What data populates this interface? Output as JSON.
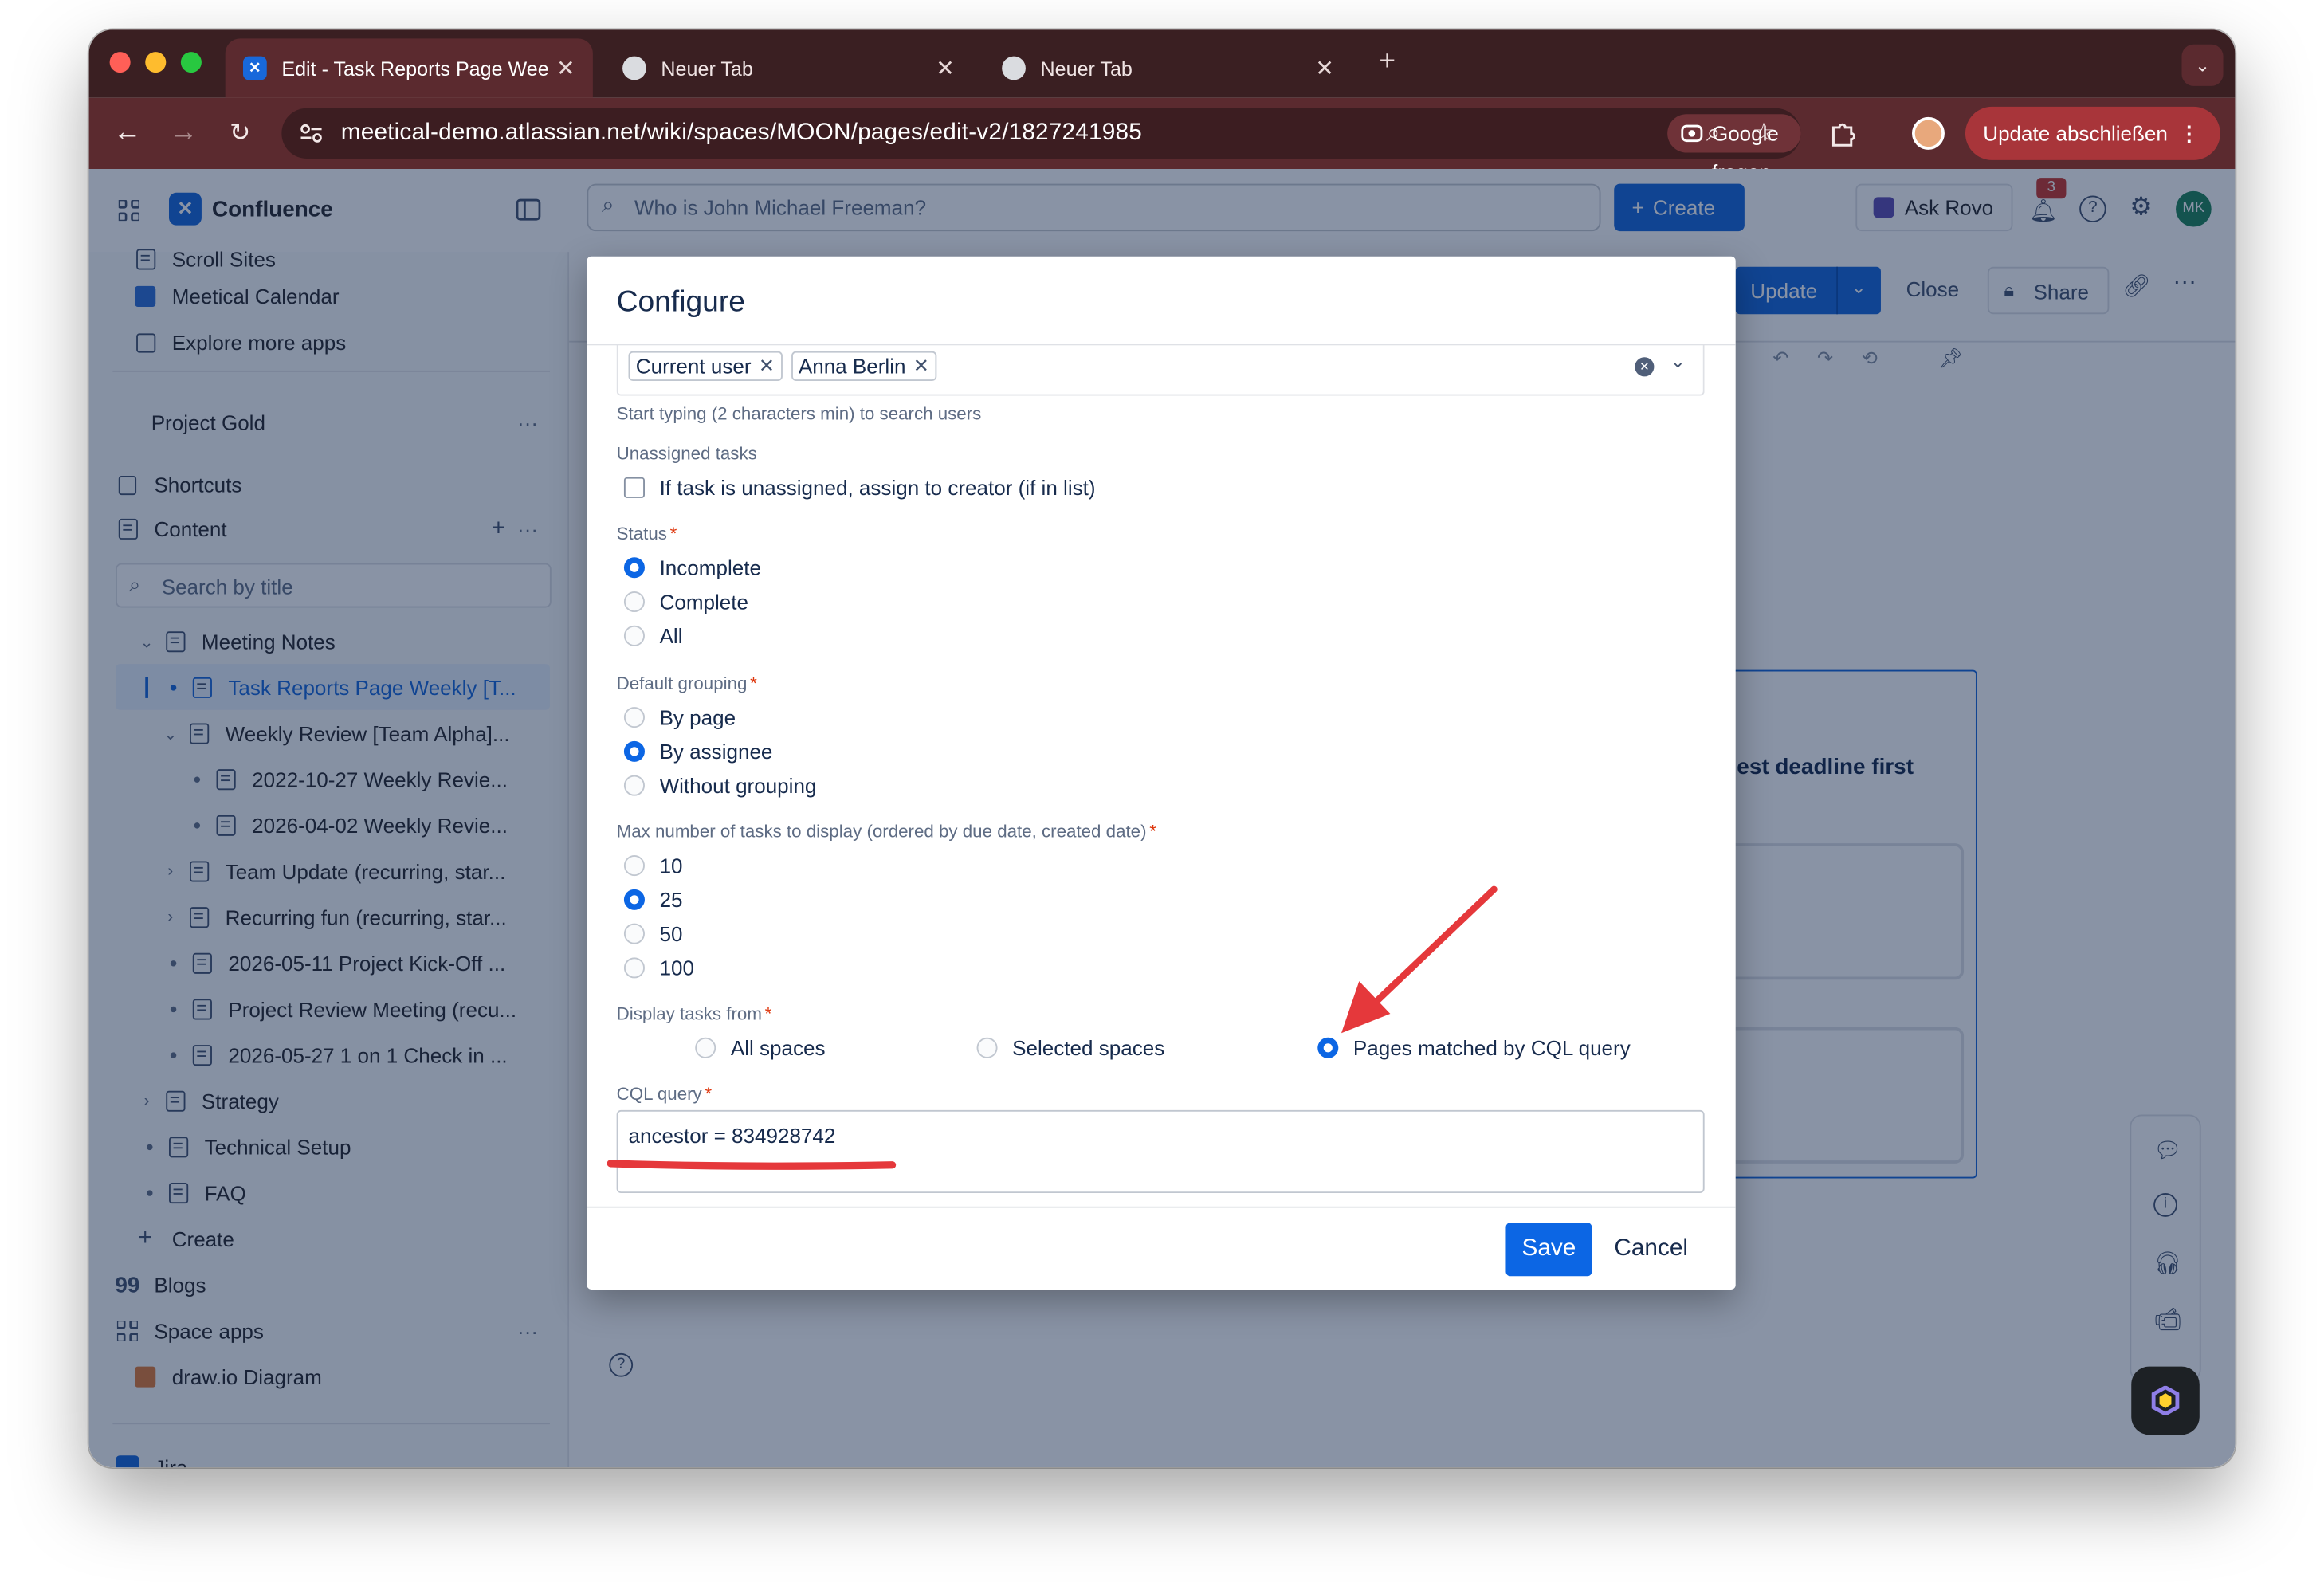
{
  "browser": {
    "tabs": [
      {
        "title": "Edit - Task Reports Page Wee"
      },
      {
        "title": "Neuer Tab"
      },
      {
        "title": "Neuer Tab"
      }
    ],
    "url": "meetical-demo.atlassian.net/wiki/spaces/MOON/pages/edit-v2/1827241985",
    "google_button": "Google fragen",
    "update_button": "Update abschließen",
    "avatar_color": "#e8a87c"
  },
  "topbar": {
    "product": "Confluence",
    "search_placeholder": "Who is John Michael Freeman?",
    "create_label": "Create",
    "rovo_label": "Ask Rovo",
    "notification_count": "3",
    "user_initials": "MK"
  },
  "editor_toolbar": {
    "update_label": "Update",
    "close_label": "Close",
    "share_label": "Share"
  },
  "sidebar": {
    "items": [
      {
        "label": "Scroll Sites"
      },
      {
        "label": "Meetical Calendar"
      },
      {
        "label": "Explore more apps"
      },
      {
        "label": "Project Gold"
      },
      {
        "label": "Shortcuts"
      },
      {
        "label": "Content"
      }
    ],
    "search_placeholder": "Search by title",
    "tree": [
      {
        "label": "Meeting Notes"
      },
      {
        "label": "Task Reports Page Weekly [T..."
      },
      {
        "label": "Weekly Review [Team Alpha]..."
      },
      {
        "label": "2022-10-27 Weekly Revie..."
      },
      {
        "label": "2026-04-02 Weekly Revie..."
      },
      {
        "label": "Team Update (recurring, star..."
      },
      {
        "label": "Recurring fun (recurring, star..."
      },
      {
        "label": "2026-05-11 Project Kick-Off ..."
      },
      {
        "label": "Project Review Meeting (recu..."
      },
      {
        "label": "2026-05-27 1 on 1 Check in ..."
      },
      {
        "label": "Strategy"
      },
      {
        "label": "Technical Setup"
      },
      {
        "label": "FAQ"
      }
    ],
    "create_label": "Create",
    "blogs_label": "Blogs",
    "space_apps_label": "Space apps",
    "drawio_label": "draw.io Diagram",
    "jira_label": "Jira"
  },
  "background_text": "earliest deadline first",
  "dialog": {
    "title": "Configure",
    "users": [
      "Current user",
      "Anna Berlin"
    ],
    "users_hint": "Start typing (2 characters min) to search users",
    "unassigned_label": "Unassigned tasks",
    "unassigned_checkbox": "If task is unassigned, assign to creator (if in list)",
    "status_label": "Status",
    "status_options": [
      "Incomplete",
      "Complete",
      "All"
    ],
    "status_selected": "Incomplete",
    "grouping_label": "Default grouping",
    "grouping_options": [
      "By page",
      "By assignee",
      "Without grouping"
    ],
    "grouping_selected": "By assignee",
    "max_label": "Max number of tasks to display (ordered by due date, created date)",
    "max_options": [
      "10",
      "25",
      "50",
      "100"
    ],
    "max_selected": "25",
    "source_label": "Display tasks from",
    "source_options": [
      "All spaces",
      "Selected spaces",
      "Pages matched by CQL query"
    ],
    "source_selected": "Pages matched by CQL query",
    "cql_label": "CQL query",
    "cql_value": "ancestor = 834928742",
    "save_label": "Save",
    "cancel_label": "Cancel"
  },
  "colors": {
    "accent": "#0c66e4",
    "annotation": "#e5383b",
    "chrome": "#5b2a2f"
  }
}
